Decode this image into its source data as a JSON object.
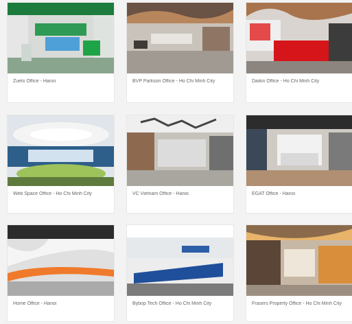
{
  "gallery": {
    "items": [
      {
        "caption": "Zuelo Office - Hanoi"
      },
      {
        "caption": "BVP Parkson Office - Ho Chi Minh City"
      },
      {
        "caption": "Daikin Office - Ho Chi Minh City"
      },
      {
        "caption": "Web Space Office - Ho Chi Minh City"
      },
      {
        "caption": "VC Vietnam Office - Hanoi"
      },
      {
        "caption": "EGAT Office - Hanoi"
      },
      {
        "caption": "Home Office - Hanoi"
      },
      {
        "caption": "Bybop Tech Office - Ho Chi Minh City"
      },
      {
        "caption": "Frasers Property Office - Ho Chi Minh City"
      }
    ]
  }
}
